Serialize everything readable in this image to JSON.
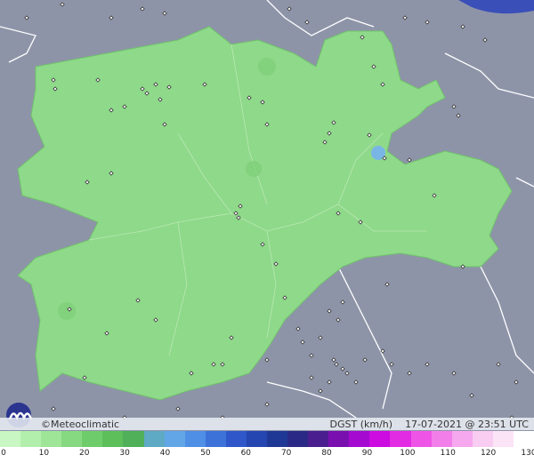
{
  "map": {
    "brand_text": "©Meteoclimatic",
    "variable_label": "DGST (km/h)",
    "timestamp": "17-07-2021 @ 23:51 UTC",
    "colors": {
      "background_terrain": "#8e94a8",
      "region_fill": "#8fd98a",
      "region_edge": "#6fc46a",
      "station": "#ffffff"
    }
  },
  "legend": {
    "ticks": [
      "0",
      "10",
      "20",
      "30",
      "40",
      "50",
      "60",
      "70",
      "80",
      "90",
      "100",
      "110",
      "120",
      "130"
    ],
    "colors": [
      "#c8f7c3",
      "#b2efac",
      "#9ee597",
      "#86d980",
      "#6fcc6a",
      "#5cbf5a",
      "#4fb059",
      "#5ea9c4",
      "#62a6e8",
      "#4f8fe6",
      "#3d72d9",
      "#2f57c9",
      "#2545b0",
      "#1f3795",
      "#2a2a86",
      "#4b1e8f",
      "#7a0fb0",
      "#a40ad0",
      "#cc0ce0",
      "#e22ce3",
      "#ee55e6",
      "#f27fe9",
      "#f6a8ee",
      "#f9ccf2",
      "#fce4f7",
      "#ffffff"
    ]
  }
}
